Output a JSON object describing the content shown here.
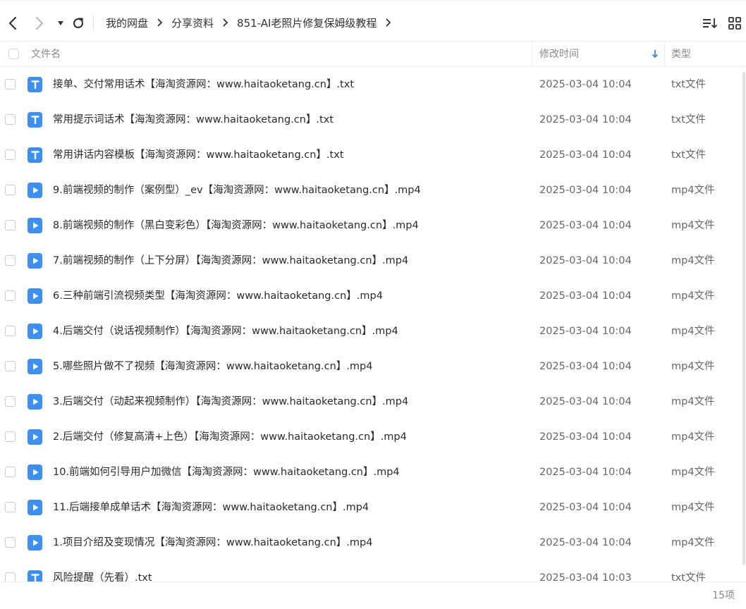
{
  "breadcrumb": [
    "我的网盘",
    "分享资料",
    "851-AI老照片修复保姆级教程"
  ],
  "header": {
    "name_label": "文件名",
    "date_label": "修改时间",
    "type_label": "类型"
  },
  "files": [
    {
      "name": "接单、交付常用话术【海淘资源网：www.haitaoketang.cn】.txt",
      "date": "2025-03-04 10:04",
      "type": "txt文件",
      "icon": "text-file-icon"
    },
    {
      "name": "常用提示词话术【海淘资源网：www.haitaoketang.cn】.txt",
      "date": "2025-03-04 10:04",
      "type": "txt文件",
      "icon": "text-file-icon"
    },
    {
      "name": "常用讲话内容模板【海淘资源网：www.haitaoketang.cn】.txt",
      "date": "2025-03-04 10:04",
      "type": "txt文件",
      "icon": "text-file-icon"
    },
    {
      "name": "9.前端视频的制作（案例型）_ev【海淘资源网：www.haitaoketang.cn】.mp4",
      "date": "2025-03-04 10:04",
      "type": "mp4文件",
      "icon": "video-file-icon"
    },
    {
      "name": "8.前端视频的制作（黑白变彩色）【海淘资源网：www.haitaoketang.cn】.mp4",
      "date": "2025-03-04 10:04",
      "type": "mp4文件",
      "icon": "video-file-icon"
    },
    {
      "name": "7.前端视频的制作（上下分屏）【海淘资源网：www.haitaoketang.cn】.mp4",
      "date": "2025-03-04 10:04",
      "type": "mp4文件",
      "icon": "video-file-icon"
    },
    {
      "name": "6.三种前端引流视频类型【海淘资源网：www.haitaoketang.cn】.mp4",
      "date": "2025-03-04 10:04",
      "type": "mp4文件",
      "icon": "video-file-icon"
    },
    {
      "name": "4.后端交付（说话视频制作）【海淘资源网：www.haitaoketang.cn】.mp4",
      "date": "2025-03-04 10:04",
      "type": "mp4文件",
      "icon": "video-file-icon"
    },
    {
      "name": "5.哪些照片做不了视频【海淘资源网：www.haitaoketang.cn】.mp4",
      "date": "2025-03-04 10:04",
      "type": "mp4文件",
      "icon": "video-file-icon"
    },
    {
      "name": "3.后端交付（动起来视频制作）【海淘资源网：www.haitaoketang.cn】.mp4",
      "date": "2025-03-04 10:04",
      "type": "mp4文件",
      "icon": "video-file-icon"
    },
    {
      "name": "2.后端交付（修复高清+上色）【海淘资源网：www.haitaoketang.cn】.mp4",
      "date": "2025-03-04 10:04",
      "type": "mp4文件",
      "icon": "video-file-icon"
    },
    {
      "name": "10.前端如何引导用户加微信【海淘资源网：www.haitaoketang.cn】.mp4",
      "date": "2025-03-04 10:04",
      "type": "mp4文件",
      "icon": "video-file-icon"
    },
    {
      "name": "11.后端接单成单话术【海淘资源网：www.haitaoketang.cn】.mp4",
      "date": "2025-03-04 10:04",
      "type": "mp4文件",
      "icon": "video-file-icon"
    },
    {
      "name": "1.项目介绍及变现情况【海淘资源网：www.haitaoketang.cn】.mp4",
      "date": "2025-03-04 10:04",
      "type": "mp4文件",
      "icon": "video-file-icon"
    },
    {
      "name": "风险提醒（先看）.txt",
      "date": "2025-03-04 10:03",
      "type": "txt文件",
      "icon": "text-file-icon"
    }
  ],
  "footer": {
    "count": "15项"
  },
  "colors": {
    "accent": "#3d8ff5",
    "sort_arrow": "#2f86f0"
  }
}
